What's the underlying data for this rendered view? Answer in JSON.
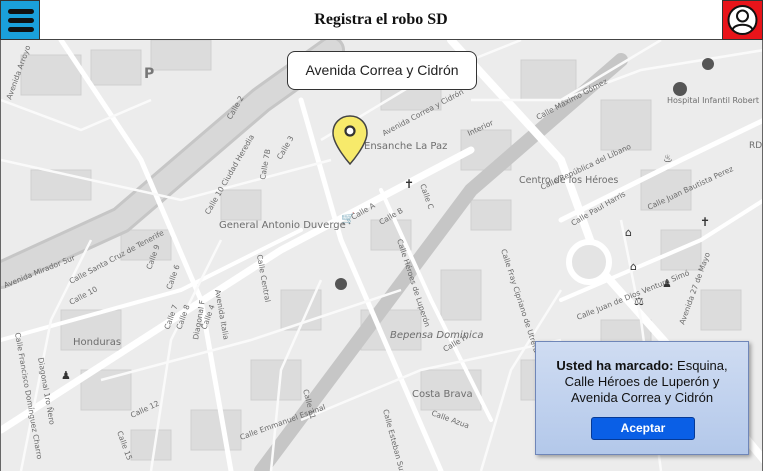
{
  "header": {
    "title": "Registra el robo SD",
    "menu_icon": "hamburger-menu-icon",
    "user_icon": "user-profile-icon",
    "menu_color": "#1aa0db",
    "user_color": "#e8141a"
  },
  "map": {
    "selected_address": "Avenida Correa y Cidrón",
    "pin_icon": "map-marker-icon",
    "pin_color": "#f7ea6b",
    "labels": {
      "ensanche": "Ensanche La Paz",
      "centro": "Centro de los Héroes",
      "general": "General Antonio Duverge",
      "honduras": "Honduras",
      "bepensa": "Bepensa Dominica",
      "costa": "Costa Brava",
      "hospital": "Hospital Infantil Robert Reid Cabral",
      "mirador": "Avenida Mirador Sur",
      "heroes": "Calle Héroes de Luperón",
      "correa": "Avenida Correa y Cidrón",
      "libano": "Calle República del Líbano",
      "bautista": "Calle Juan Bautista Perez",
      "maximo": "Calle Máximo Gómez",
      "fray": "Calle Fray Cipriano de Utrera",
      "paul": "Calle Paul Harris",
      "ciudad": "Calle 10 Ciudad Heredia",
      "central": "Calle Central",
      "italia": "Avenida Italia",
      "santacruz": "Calle Santa Cruz de Tenerife",
      "mayo": "Avenida 27 de Mayo",
      "calle10": "Calle 10",
      "calle11": "Calle 11",
      "calle12": "Calle 12",
      "calle15": "Calle 15",
      "calle9": "Calle 9",
      "calle6": "Calle 6",
      "calle7": "Calle 7",
      "calleB": "Calle B",
      "calleA": "Calle A",
      "calleH": "Calle H",
      "calleC": "Calle C",
      "calleAzua": "Calle Azua",
      "calleEsteban": "Calle Esteban Suazo",
      "calleEmmanuel": "Calle Emmanuel Espinal",
      "calleFrancisco": "Calle Francisco Domínguez Charro",
      "calleJuanDeDios": "Calle Juan de Dios Ventura Simó",
      "diagonal": "Diagonal 1ro Ñero",
      "diagonalF": "Diagonal F",
      "arroyo": "Avenida Arroyo",
      "parking": "P",
      "rd": "RD",
      "calle7b": "Calle 7B",
      "calle8": "Calle 8",
      "interior": "Interior",
      "calle4": "Calle 4",
      "calle2": "Calle 2",
      "calle3": "Calle 3"
    }
  },
  "dialog": {
    "prefix": "Usted ha marcado:",
    "message": " Esquina, Calle Héroes de Luperón y Avenida Correa y Cidrón",
    "accept_label": "Aceptar"
  }
}
